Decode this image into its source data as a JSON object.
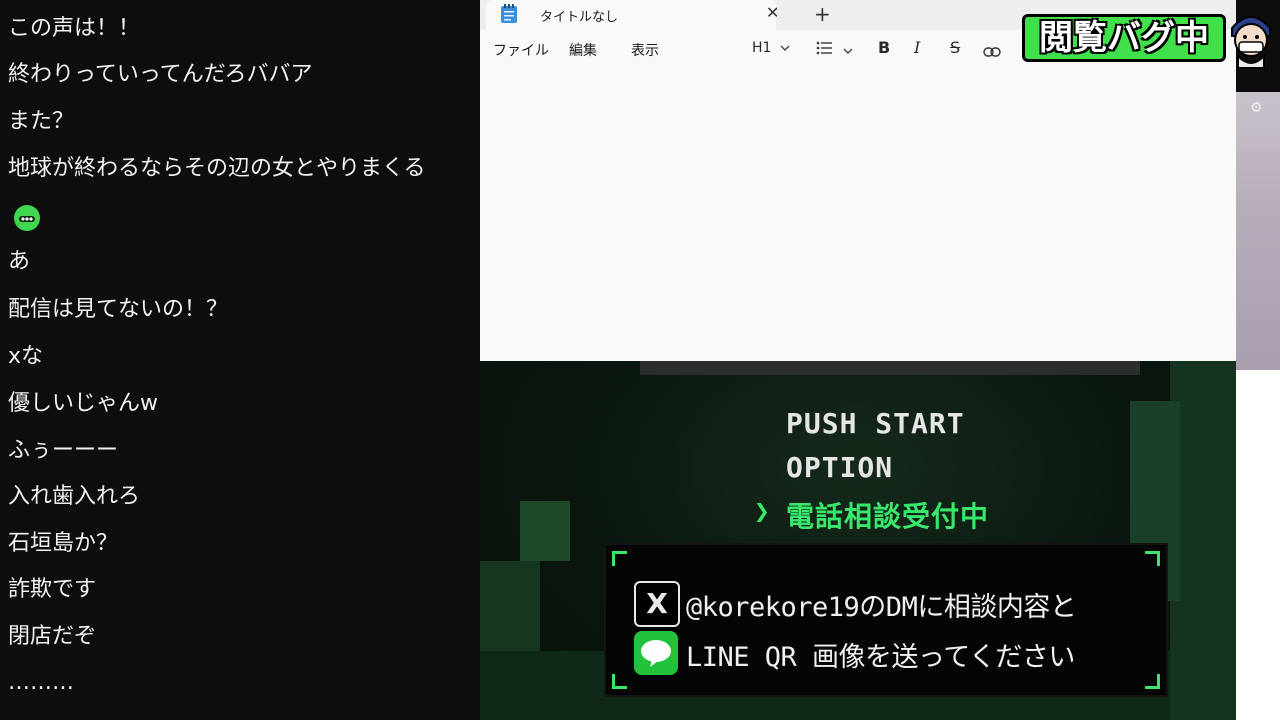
{
  "chat": {
    "messages": [
      "この声は！！",
      "終わりっていってんだろババア",
      "また？",
      "地球が終わるならその辺の女とやりまくる",
      "",
      "あ",
      "配信は見てないの！？",
      "xな",
      "優しいじゃんw",
      "ふぅーーー",
      "入れ歯入れろ",
      "石垣島か？",
      "詐欺です",
      "閉店だぞ",
      "………"
    ],
    "emote_icon": "green-smiley-emote-icon"
  },
  "notepad": {
    "tab_title": "タイトルなし",
    "new_tab": "+",
    "close": "✕",
    "menu": {
      "file": "ファイル",
      "edit": "編集",
      "view": "表示"
    },
    "toolbar": {
      "heading": "H1",
      "bold": "B",
      "italic": "I",
      "strike": "S"
    }
  },
  "game": {
    "menu": {
      "push_start": "PUSH START",
      "option": "OPTION",
      "selected": "電話相談受付中",
      "arrow": "❯"
    },
    "contact": {
      "x_line": "@korekore19のDMに相談内容と",
      "line_line": "LINE QR 画像を送ってください",
      "x_logo": "X"
    }
  },
  "overlay": {
    "badge": "閲覧バグ中"
  },
  "colors": {
    "accent_green": "#38e86a",
    "badge_green": "#3fe04a",
    "line_green": "#22c33a"
  }
}
